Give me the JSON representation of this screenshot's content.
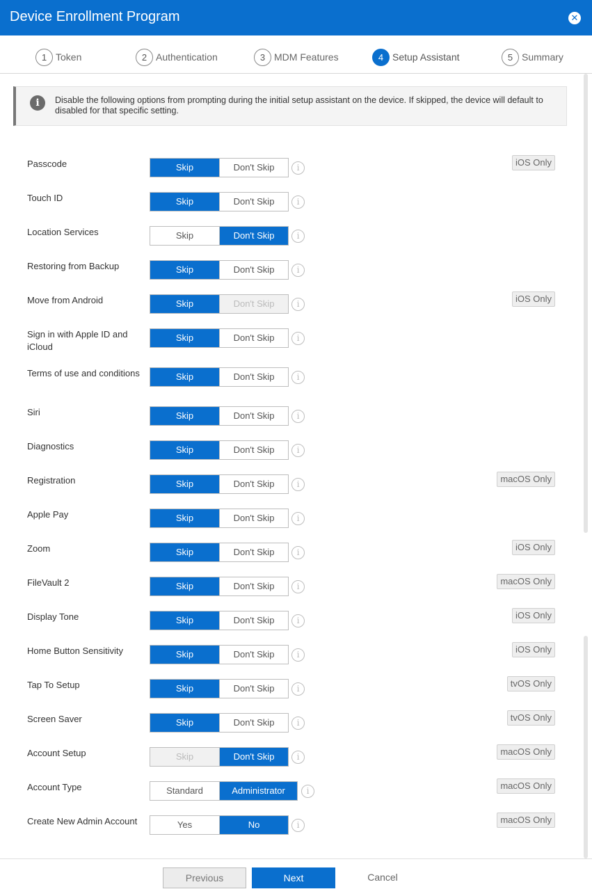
{
  "window": {
    "title": "Device Enrollment Program"
  },
  "steps": [
    {
      "num": "1",
      "label": "Token"
    },
    {
      "num": "2",
      "label": "Authentication"
    },
    {
      "num": "3",
      "label": "MDM Features"
    },
    {
      "num": "4",
      "label": "Setup Assistant",
      "active": true
    },
    {
      "num": "5",
      "label": "Summary"
    }
  ],
  "info": {
    "icon": "info-icon",
    "text": "Disable the following options from prompting during the initial setup assistant on the device. If skipped, the device will default to disabled for that specific setting."
  },
  "options": [
    {
      "label": "Passcode",
      "left": "Skip",
      "right": "Don't Skip",
      "selected": "left",
      "badge": "iOS Only"
    },
    {
      "label": "Touch ID",
      "left": "Skip",
      "right": "Don't Skip",
      "selected": "left",
      "badge": ""
    },
    {
      "label": "Location Services",
      "left": "Skip",
      "right": "Don't Skip",
      "selected": "right",
      "badge": ""
    },
    {
      "label": "Restoring from Backup",
      "left": "Skip",
      "right": "Don't Skip",
      "selected": "left",
      "badge": ""
    },
    {
      "label": "Move from Android",
      "left": "Skip",
      "right": "Don't Skip",
      "selected": "left",
      "disabled": "right",
      "badge": "iOS Only"
    },
    {
      "label": "Sign in with Apple ID and iCloud",
      "left": "Skip",
      "right": "Don't Skip",
      "selected": "left",
      "badge": ""
    },
    {
      "label": "Terms of use and conditions",
      "left": "Skip",
      "right": "Don't Skip",
      "selected": "left",
      "badge": ""
    },
    {
      "label": "Siri",
      "left": "Skip",
      "right": "Don't Skip",
      "selected": "left",
      "badge": ""
    },
    {
      "label": "Diagnostics",
      "left": "Skip",
      "right": "Don't Skip",
      "selected": "left",
      "badge": ""
    },
    {
      "label": "Registration",
      "left": "Skip",
      "right": "Don't Skip",
      "selected": "left",
      "badge": "macOS Only"
    },
    {
      "label": "Apple Pay",
      "left": "Skip",
      "right": "Don't Skip",
      "selected": "left",
      "badge": ""
    },
    {
      "label": "Zoom",
      "left": "Skip",
      "right": "Don't Skip",
      "selected": "left",
      "badge": "iOS Only"
    },
    {
      "label": "FileVault 2",
      "left": "Skip",
      "right": "Don't Skip",
      "selected": "left",
      "badge": "macOS Only"
    },
    {
      "label": "Display Tone",
      "left": "Skip",
      "right": "Don't Skip",
      "selected": "left",
      "badge": "iOS Only"
    },
    {
      "label": "Home Button Sensitivity",
      "left": "Skip",
      "right": "Don't Skip",
      "selected": "left",
      "badge": "iOS Only"
    },
    {
      "label": "Tap To Setup",
      "left": "Skip",
      "right": "Don't Skip",
      "selected": "left",
      "badge": "tvOS Only"
    },
    {
      "label": "Screen Saver",
      "left": "Skip",
      "right": "Don't Skip",
      "selected": "left",
      "badge": "tvOS Only"
    },
    {
      "label": "Account Setup",
      "left": "Skip",
      "right": "Don't Skip",
      "selected": "right",
      "disabled": "left",
      "badge": "macOS Only"
    },
    {
      "label": "Account Type",
      "left": "Standard",
      "right": "Administrator",
      "selected": "right",
      "badge": "macOS Only"
    },
    {
      "label": "Create New Admin Account",
      "left": "Yes",
      "right": "No",
      "selected": "right",
      "badge": "macOS Only"
    }
  ],
  "footer": {
    "previous": "Previous",
    "next": "Next",
    "cancel": "Cancel"
  },
  "colors": {
    "accent": "#0a6fce",
    "badge_bg": "#eeeeee",
    "info_bg": "#f4f4f4"
  }
}
